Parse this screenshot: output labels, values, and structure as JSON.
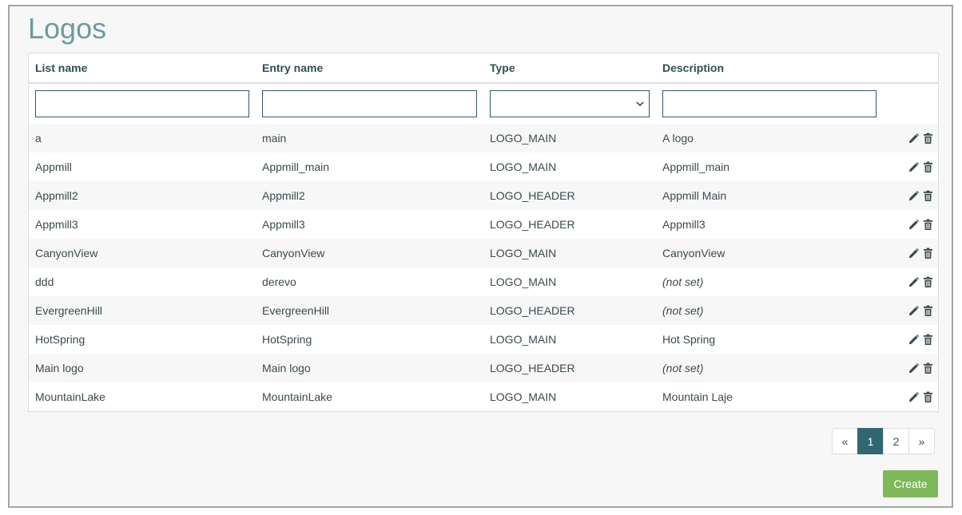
{
  "page": {
    "title": "Logos"
  },
  "table": {
    "columns": {
      "list_name": "List name",
      "entry_name": "Entry name",
      "type": "Type",
      "description": "Description"
    },
    "filters": {
      "list_name": "",
      "entry_name": "",
      "type": "",
      "description": ""
    },
    "rows": [
      {
        "list_name": "a",
        "entry_name": "main",
        "type": "LOGO_MAIN",
        "description": "A logo",
        "description_not_set": false
      },
      {
        "list_name": "Appmill",
        "entry_name": "Appmill_main",
        "type": "LOGO_MAIN",
        "description": "Appmill_main",
        "description_not_set": false
      },
      {
        "list_name": "Appmill2",
        "entry_name": "Appmill2",
        "type": "LOGO_HEADER",
        "description": "Appmill Main",
        "description_not_set": false
      },
      {
        "list_name": "Appmill3",
        "entry_name": "Appmill3",
        "type": "LOGO_HEADER",
        "description": "Appmill3",
        "description_not_set": false
      },
      {
        "list_name": "CanyonView",
        "entry_name": "CanyonView",
        "type": "LOGO_MAIN",
        "description": "CanyonView",
        "description_not_set": false
      },
      {
        "list_name": "ddd",
        "entry_name": "derevo",
        "type": "LOGO_MAIN",
        "description": "(not set)",
        "description_not_set": true
      },
      {
        "list_name": "EvergreenHill",
        "entry_name": "EvergreenHill",
        "type": "LOGO_HEADER",
        "description": "(not set)",
        "description_not_set": true
      },
      {
        "list_name": "HotSpring",
        "entry_name": "HotSpring",
        "type": "LOGO_MAIN",
        "description": "Hot Spring",
        "description_not_set": false
      },
      {
        "list_name": "Main logo",
        "entry_name": "Main logo",
        "type": "LOGO_HEADER",
        "description": "(not set)",
        "description_not_set": true
      },
      {
        "list_name": "MountainLake",
        "entry_name": "MountainLake",
        "type": "LOGO_MAIN",
        "description": "Mountain Laje",
        "description_not_set": false
      }
    ],
    "row_actions": [
      "pencil-icon",
      "trash-icon"
    ]
  },
  "pagination": {
    "prev": "«",
    "pages": [
      "1",
      "2"
    ],
    "current": "1",
    "next": "»"
  },
  "actions": {
    "create_label": "Create"
  },
  "colors": {
    "title": "#6f9aa2",
    "active_page": "#336673",
    "create_button": "#7fb85a",
    "not_set": "#c0504d"
  }
}
